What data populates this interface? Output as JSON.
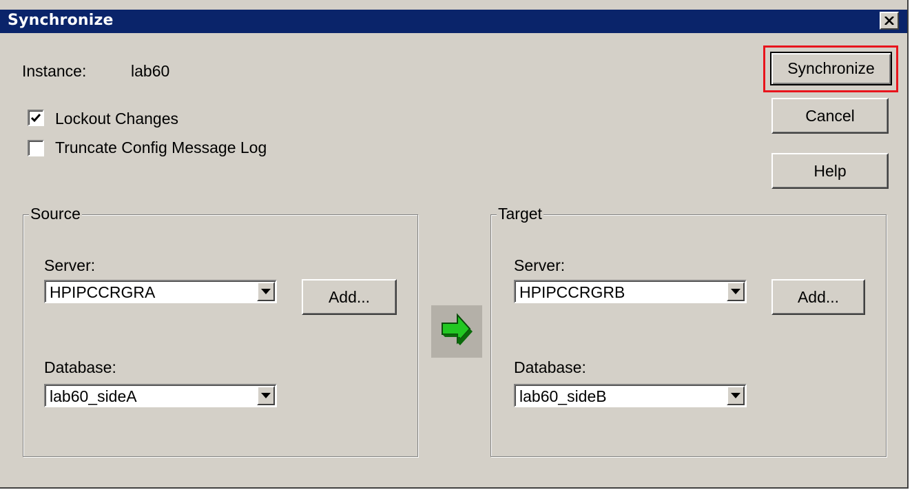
{
  "window": {
    "title": "Synchronize"
  },
  "instance": {
    "label": "Instance:",
    "value": "lab60"
  },
  "options": {
    "lockout": {
      "label": "Lockout Changes",
      "checked": true
    },
    "truncate": {
      "label": "Truncate Config Message Log",
      "checked": false
    }
  },
  "buttons": {
    "synchronize": "Synchronize",
    "cancel": "Cancel",
    "help": "Help"
  },
  "source": {
    "title": "Source",
    "server_label": "Server:",
    "server_value": "HPIPCCRGRA",
    "add_label": "Add...",
    "database_label": "Database:",
    "database_value": "lab60_sideA"
  },
  "target": {
    "title": "Target",
    "server_label": "Server:",
    "server_value": "HPIPCCRGRB",
    "add_label": "Add...",
    "database_label": "Database:",
    "database_value": "lab60_sideB"
  },
  "icons": {
    "close": "close-icon",
    "check": "checkmark-icon",
    "dropdown": "dropdown-arrow-icon",
    "sync_direction": "green-right-arrow-icon"
  },
  "colors": {
    "titlebar": "#0a246a",
    "face": "#d4d0c8",
    "highlight": "#e8141c",
    "arrow_green": "#22c822"
  }
}
